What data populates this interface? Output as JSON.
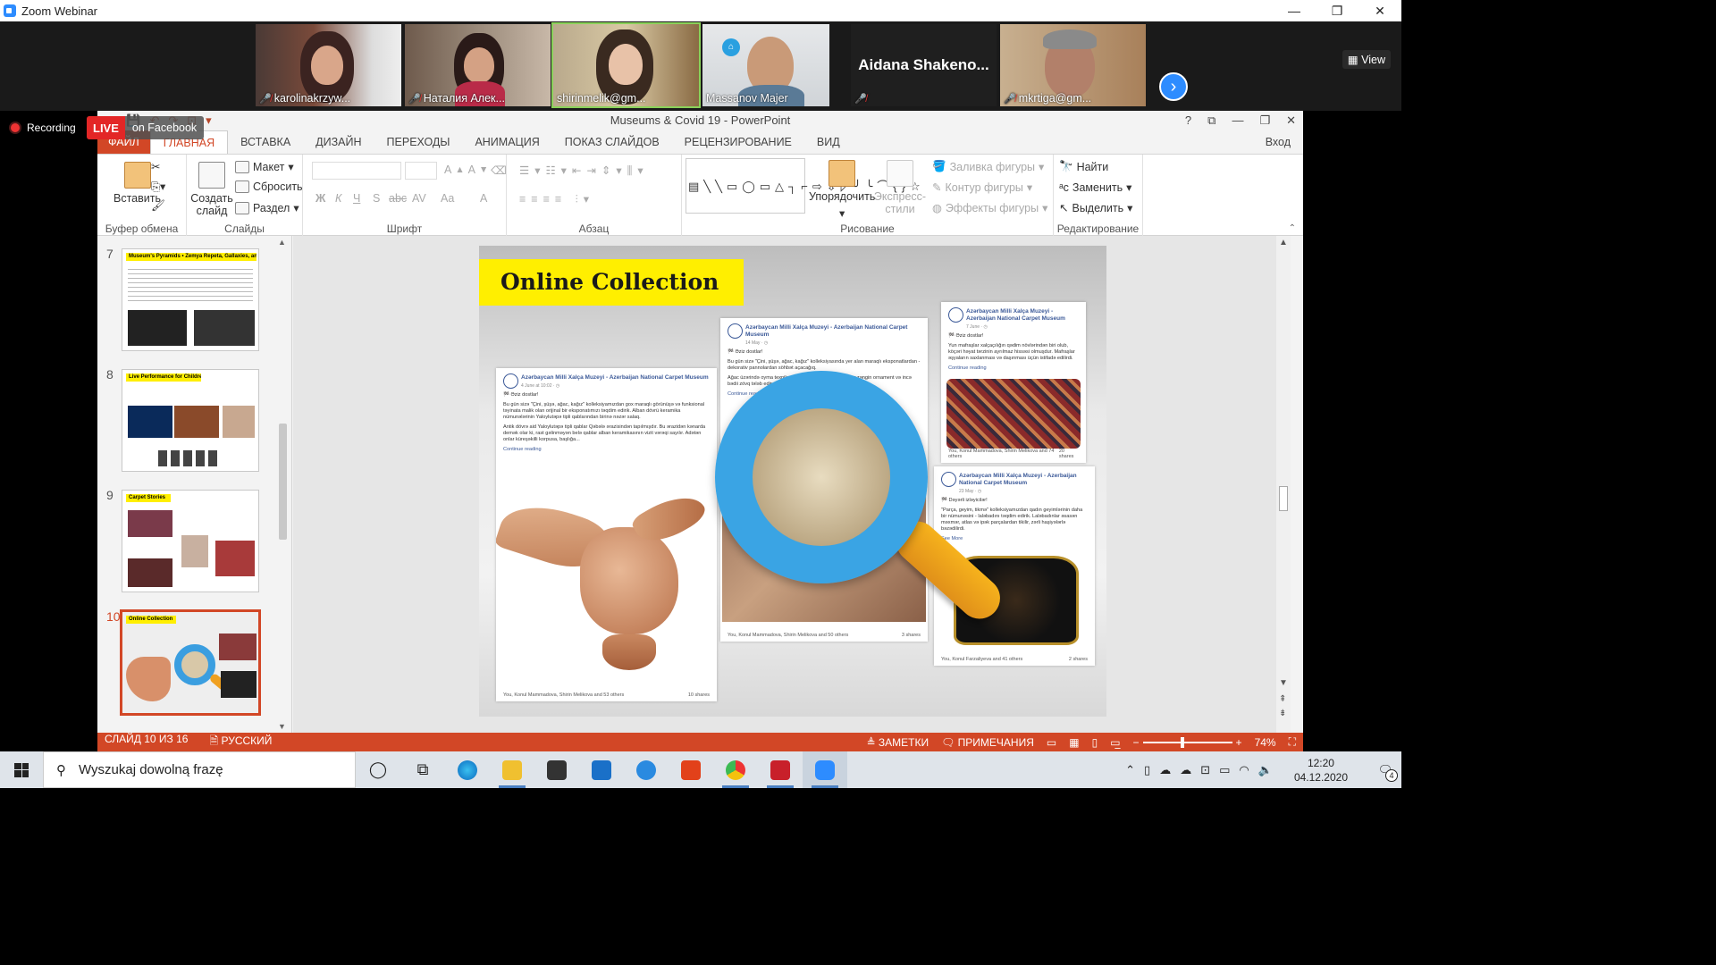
{
  "window": {
    "title": "Zoom Webinar",
    "controls": [
      "—",
      "❐",
      "✕"
    ]
  },
  "participants": [
    {
      "name": "karolinakrzyw...",
      "muted": true
    },
    {
      "name": "Наталия Алек...",
      "muted": true
    },
    {
      "name": "shirinmelik@gm...",
      "muted": false,
      "active": true
    },
    {
      "name": "Massanov Majer",
      "muted": false
    },
    {
      "name": "Aidana Shakeno...",
      "muted": true,
      "video": false
    },
    {
      "name": "mkrtiga@gm...",
      "muted": true
    }
  ],
  "view_button": "View",
  "recording": "Recording",
  "live": {
    "label": "LIVE",
    "platform": "on Facebook"
  },
  "ppt": {
    "title": "Museums & Covid 19 - PowerPoint",
    "title_buttons": [
      "?",
      "⧉",
      "—",
      "❐",
      "✕"
    ],
    "tabs": [
      "ФАЙЛ",
      "ГЛАВНАЯ",
      "ВСТАВКА",
      "ДИЗАЙН",
      "ПЕРЕХОДЫ",
      "АНИМАЦИЯ",
      "ПОКАЗ СЛАЙДОВ",
      "РЕЦЕНЗИРОВАНИЕ",
      "ВИД"
    ],
    "login": "Вход",
    "ribbon": {
      "clipboard": {
        "label": "Буфер обмена",
        "paste": "Вставить"
      },
      "slides": {
        "label": "Слайды",
        "new": "Создать слайд",
        "layout": "Макет",
        "reset": "Сбросить",
        "section": "Раздел"
      },
      "font": {
        "label": "Шрифт",
        "buttons": [
          "Ж",
          "К",
          "Ч",
          "S",
          "abc",
          "AV",
          "Aa",
          "A"
        ]
      },
      "paragraph": {
        "label": "Абзац"
      },
      "drawing": {
        "label": "Рисование",
        "arrange": "Упорядочить",
        "styles": "Экспресс-стили",
        "fill": "Заливка фигуры",
        "outline": "Контур фигуры",
        "effects": "Эффекты фигуры"
      },
      "editing": {
        "label": "Редактирование",
        "find": "Найти",
        "replace": "Заменить",
        "select": "Выделить"
      }
    },
    "thumbnails": [
      {
        "num": "7",
        "title": "Museum's Pyramids • Zemya Repeta, Gallaxies, and Philanthropies"
      },
      {
        "num": "8",
        "title": "Live Performance for Children"
      },
      {
        "num": "9",
        "title": "Carpet Stories"
      },
      {
        "num": "10",
        "title": "Online Collection",
        "selected": true
      }
    ],
    "slide": {
      "title": "Online Collection",
      "posts": [
        {
          "page": "Azərbaycan Milli Xalça Muzeyi - Azerbaijan National Carpet Museum",
          "date": "4 June at 10:02 · ◷",
          "text1": "🏁 Əziz dostlar!",
          "text2": "Bu gün sizə \"Çini, şüşə, ağac, kağız\" kolleksiyamızdan gox maraqlı görünüşə və funksional təyinata malik olan orijinal bir eksponatımızı təqdim edirik. Alban dövrü keramika nümunələrinin Yaloylutəpə tipli qablarından birinə nəzər salaq.",
          "text3": "Antik dövrə aid Yaloylutəpə tipli qablar Qəbələ ərazisindən tapılmışdır. Bu ərazidən kənarda demək olar ki, rast gəlinməyən belə qablar alban keramikasının vizit vərəqi sayılır. Adətən onlar küreşəkilli korpusa, başlığa...",
          "more": "Continue reading",
          "reactions": "You, Konul Mammadova, Shirin Melikova and 53 others",
          "shares": "10 shares"
        },
        {
          "page": "Azərbaycan Milli Xalça Muzeyi - Azerbaijan National Carpet Museum",
          "date": "14 May · ◷",
          "text1": "🏁 Əziz dostlar!",
          "text2": "Bu gün sizə \"Çini, şüşə, ağac, kağız\" kolleksiyasında yer alan maraqlı eksponatlardan - dekorativ pannolardan söhbət açacağıq.",
          "text3": "Ağac üzərində oyma texnikası ilə hazırlanmış bu pannolar zəngin ornament və incə bədii zövq tələb edir...",
          "more": "Continue reading",
          "reactions": "You, Konul Mammadova, Shirin Melikova and 50 others",
          "shares": "3 shares"
        },
        {
          "page": "Azərbaycan Milli Xalça Muzeyi - Azerbaijan National Carpet Museum",
          "date": "7 June · ◷",
          "text1": "🏁 Əziz dostlar!",
          "text2": "Yun mafraşlar xalçaçılığın qədim növlərindən biri olub, köçəri həyat tərzinin ayrılmaz hissəsi olmuşdur. Mafraşlar əşyaların saxlanması və daşınması üçün istifadə edilirdi.",
          "text3": "",
          "more": "Continue reading",
          "reactions": "You, Konul Mammadova, Shirin Melikova and 74 others",
          "shares": "20 shares"
        },
        {
          "page": "Azərbaycan Milli Xalça Muzeyi - Azerbaijan National Carpet Museum",
          "date": "23 May · ◷",
          "text1": "🏁 Dəyərli izləyicilər!",
          "text2": "\"Parça, geyim, tikmə\" kolleksiyamızdan qadın geyimlərinin daha bir nümunəsini - laləbadını təqdim edirik. Laləbadınlar əsasən məxmər, atlas və ipək parçalardan tikilir, zərli haşiyələrlə bəzədilirdi.",
          "text3": "",
          "more": "See More",
          "reactions": "You, Konul Farzaliyeva and 41 others",
          "shares": "2 shares"
        }
      ]
    },
    "status": {
      "slide": "СЛАЙД 10 ИЗ 16",
      "language": "РУССКИЙ",
      "notes": "ЗАМЕТКИ",
      "comments": "ПРИМЕЧАНИЯ",
      "zoom": "74%"
    }
  },
  "taskbar": {
    "search_placeholder": "Wyszukaj dowolną frazę",
    "time": "12:20",
    "date": "04.12.2020",
    "notifications": "4"
  }
}
